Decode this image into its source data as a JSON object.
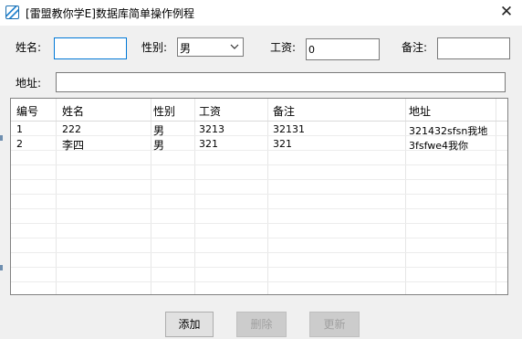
{
  "window": {
    "title": "[雷盟教你学E]数据库简单操作例程",
    "close_glyph": "✕"
  },
  "form": {
    "name_label": "姓名:",
    "name_value": "",
    "gender_label": "性别:",
    "gender_value": "男",
    "salary_label": "工资:",
    "salary_value": "0",
    "remark_label": "备注:",
    "remark_value": "",
    "address_label": "地址:",
    "address_value": ""
  },
  "table": {
    "columns": [
      "编号",
      "姓名",
      "性别",
      "工资",
      "备注",
      "地址"
    ],
    "rows": [
      [
        "1",
        "222",
        "男",
        "3213",
        "32131",
        "321432sfsn我地"
      ],
      [
        "2",
        "李四",
        "男",
        "321",
        "321",
        "3fsfwe4我你"
      ]
    ]
  },
  "buttons": {
    "add": "添加",
    "delete": "删除",
    "update": "更新"
  },
  "icons": {
    "app": "app-logo-icon",
    "close": "close-icon",
    "dropdown": "chevron-down-icon"
  },
  "colors": {
    "focus_border": "#0078d7",
    "disabled_text": "#a0a0a0"
  }
}
